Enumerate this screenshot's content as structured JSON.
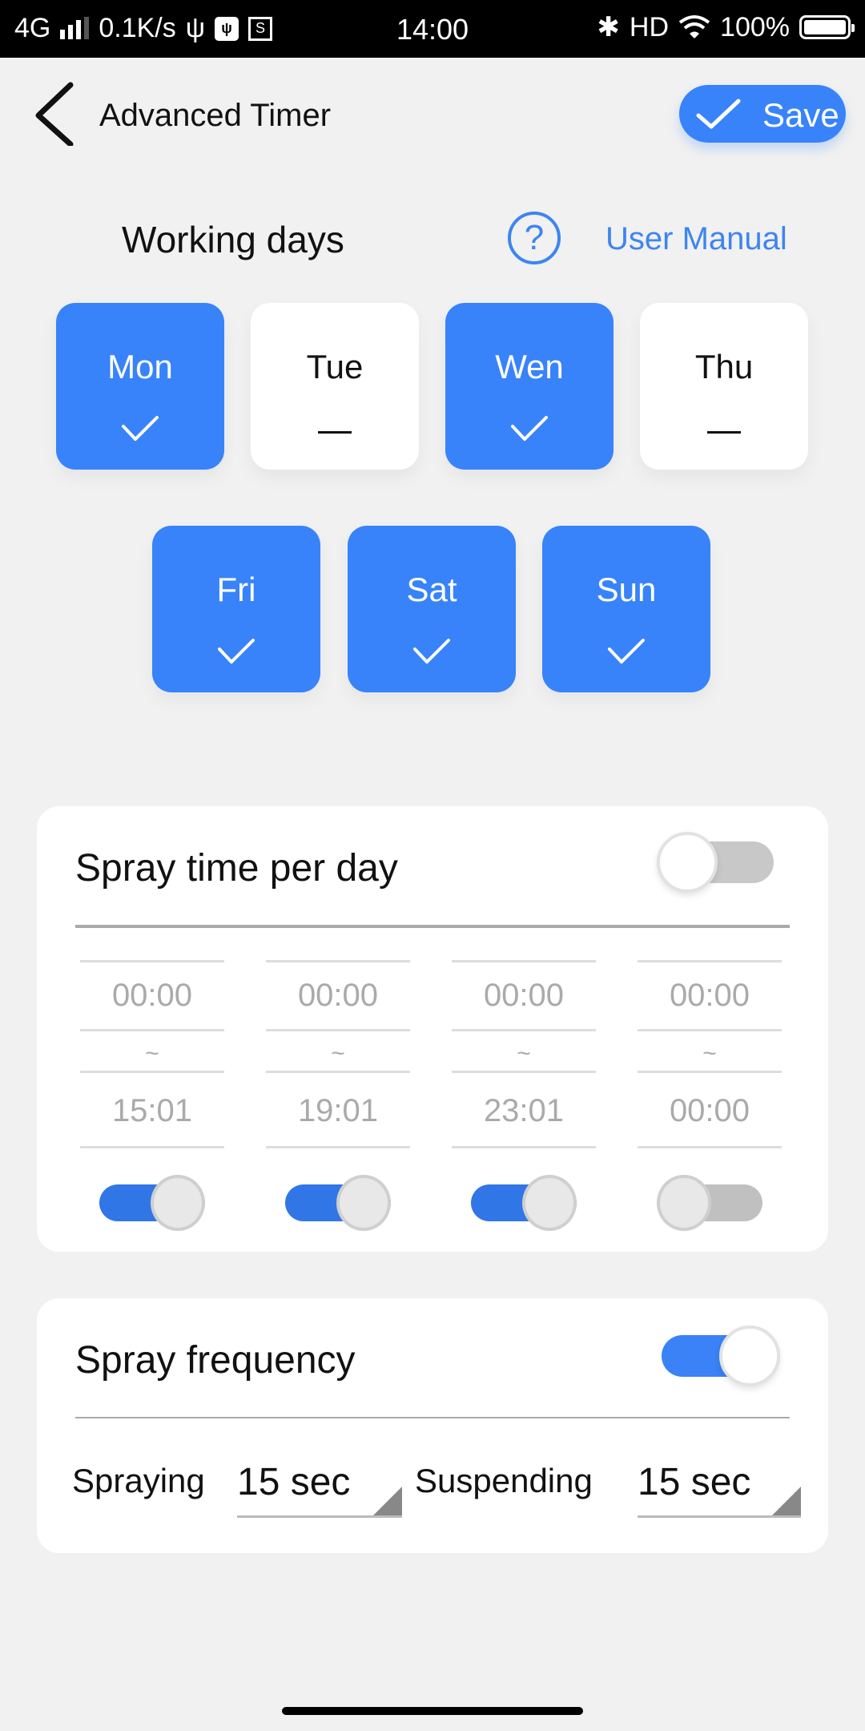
{
  "status_bar": {
    "network": "4G",
    "speed": "0.1K/s",
    "time": "14:00",
    "hd": "HD",
    "battery": "100%"
  },
  "header": {
    "title": "Advanced Timer",
    "save_label": "Save"
  },
  "working_days": {
    "title": "Working days",
    "help_glyph": "?",
    "manual_link": "User Manual",
    "days": [
      {
        "label": "Mon",
        "selected": true
      },
      {
        "label": "Tue",
        "selected": false
      },
      {
        "label": "Wen",
        "selected": true
      },
      {
        "label": "Thu",
        "selected": false
      },
      {
        "label": "Fri",
        "selected": true
      },
      {
        "label": "Sat",
        "selected": true
      },
      {
        "label": "Sun",
        "selected": true
      }
    ]
  },
  "spray_time": {
    "title": "Spray time per day",
    "enabled": false,
    "separator": "~",
    "slots": [
      {
        "start": "00:00",
        "end": "15:01",
        "enabled": true
      },
      {
        "start": "00:00",
        "end": "19:01",
        "enabled": true
      },
      {
        "start": "00:00",
        "end": "23:01",
        "enabled": true
      },
      {
        "start": "00:00",
        "end": "00:00",
        "enabled": false
      }
    ]
  },
  "spray_frequency": {
    "title": "Spray frequency",
    "enabled": true,
    "spraying_label": "Spraying",
    "spraying_value": "15 sec",
    "suspending_label": "Suspending",
    "suspending_value": "15 sec"
  },
  "colors": {
    "accent": "#3883fa",
    "link": "#3d85f0",
    "background": "#f1f1f1"
  }
}
